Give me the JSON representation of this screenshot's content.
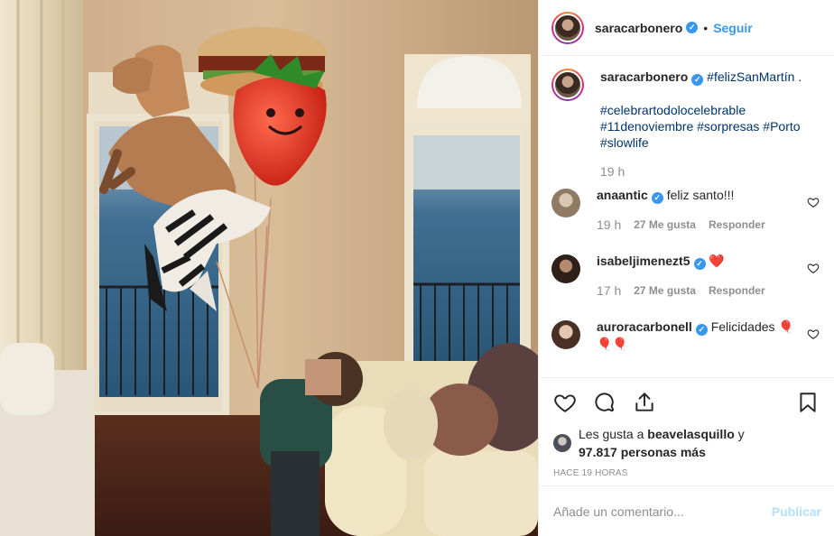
{
  "post": {
    "author": "saracarbonero",
    "follow_label": "Seguir",
    "dot": "•",
    "caption_text": "#felizSanMartín .",
    "caption_tags": "#celebrartodolocelebrable #11denoviembre #sorpresas #Porto #slowlife",
    "caption_time": "19 h"
  },
  "comments": [
    {
      "user": "anaantic",
      "text": "feliz santo!!!",
      "time": "19 h",
      "likes": "27 Me gusta",
      "reply": "Responder",
      "avatar_color": "#b8a48c"
    },
    {
      "user": "isabeljimenezt5",
      "text": "❤️",
      "time": "17 h",
      "likes": "27 Me gusta",
      "reply": "Responder",
      "avatar_color": "#3e2b22"
    },
    {
      "user": "auroracarbonell",
      "text": "Felicidades 🎈🎈🎈",
      "avatar_color": "#d9b9a6"
    }
  ],
  "actions": {
    "liked_by_prefix": "Les gusta a",
    "liked_by_user": "beavelasquillo",
    "liked_by_join": "y",
    "liked_count": "97.817 personas más",
    "time_ago": "HACE 19 HORAS"
  },
  "add_comment": {
    "placeholder": "Añade un comentario...",
    "publish_label": "Publicar"
  },
  "colors": {
    "link_blue": "#3897f0",
    "hashtag": "#003569",
    "muted": "#8e8e8e",
    "publish_disabled": "#b2dffc"
  },
  "icons": [
    "verified-badge-icon",
    "heart-icon",
    "comment-icon",
    "share-icon",
    "bookmark-icon"
  ]
}
